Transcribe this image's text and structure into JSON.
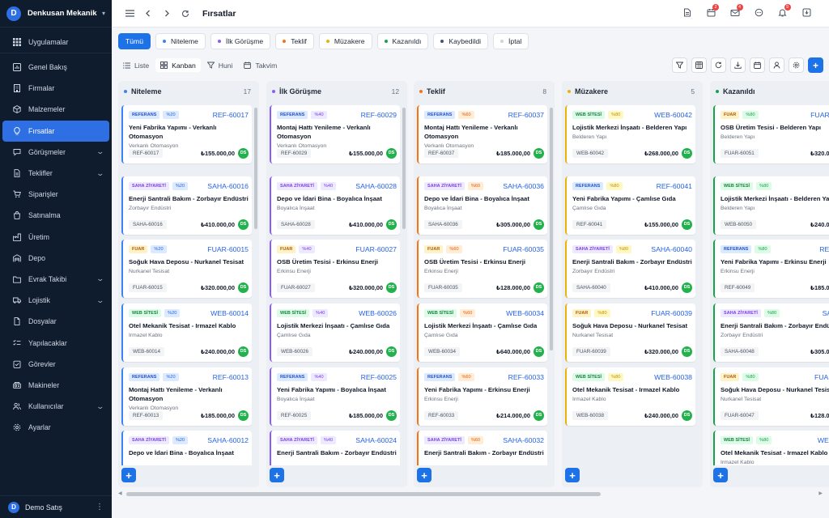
{
  "app": {
    "name": "Denkusan Mekanik San...",
    "logo_letter": "D"
  },
  "sidebar": {
    "items": [
      {
        "label": "Uygulamalar",
        "icon": "grid-icon",
        "chevron": false
      },
      {
        "label": "Genel Bakış",
        "icon": "dashboard-icon",
        "chevron": false
      },
      {
        "label": "Firmalar",
        "icon": "building-icon",
        "chevron": false
      },
      {
        "label": "Malzemeler",
        "icon": "box-icon",
        "chevron": false
      },
      {
        "label": "Fırsatlar",
        "icon": "lightbulb-icon",
        "chevron": false,
        "active": true
      },
      {
        "label": "Görüşmeler",
        "icon": "chat-icon",
        "chevron": true
      },
      {
        "label": "Teklifler",
        "icon": "document-icon",
        "chevron": true
      },
      {
        "label": "Siparişler",
        "icon": "cart-icon",
        "chevron": false
      },
      {
        "label": "Satınalma",
        "icon": "bag-icon",
        "chevron": false
      },
      {
        "label": "Üretim",
        "icon": "factory-icon",
        "chevron": false
      },
      {
        "label": "Depo",
        "icon": "warehouse-icon",
        "chevron": false
      },
      {
        "label": "Evrak Takibi",
        "icon": "folder-icon",
        "chevron": true
      },
      {
        "label": "Lojistik",
        "icon": "truck-icon",
        "chevron": true
      },
      {
        "label": "Dosyalar",
        "icon": "file-icon",
        "chevron": false
      },
      {
        "label": "Yapılacaklar",
        "icon": "checklist-icon",
        "chevron": false
      },
      {
        "label": "Görevler",
        "icon": "task-icon",
        "chevron": false
      },
      {
        "label": "Makineler",
        "icon": "machine-icon",
        "chevron": false
      },
      {
        "label": "Kullanıcılar",
        "icon": "users-icon",
        "chevron": true
      },
      {
        "label": "Ayarlar",
        "icon": "gear-icon",
        "chevron": false
      }
    ],
    "user": {
      "name": "Demo Satış",
      "initial": "D"
    }
  },
  "topbar": {
    "title": "Fırsatlar",
    "badges": {
      "calendar": "2",
      "mail": "4",
      "bell": "9"
    }
  },
  "filters": [
    {
      "label": "Tümü",
      "active": true,
      "color": ""
    },
    {
      "label": "Niteleme",
      "color": "#3b82f6"
    },
    {
      "label": "İlk Görüşme",
      "color": "#8b5cf6"
    },
    {
      "label": "Teklif",
      "color": "#f97316"
    },
    {
      "label": "Müzakere",
      "color": "#eab308"
    },
    {
      "label": "Kazanıldı",
      "color": "#16a34a"
    },
    {
      "label": "Kaybedildi",
      "color": "#475569"
    },
    {
      "label": "İptal",
      "color": "#d1d5db"
    }
  ],
  "views": [
    {
      "label": "Liste",
      "icon": "list-icon"
    },
    {
      "label": "Kanban",
      "icon": "kanban-icon",
      "active": true
    },
    {
      "label": "Huni",
      "icon": "funnel-icon"
    },
    {
      "label": "Takvim",
      "icon": "calendar-icon"
    }
  ],
  "tag_styles": {
    "REFERANS": {
      "bg": "#dbeafe",
      "fg": "#1d4ed8"
    },
    "SAHA ZİYARETİ": {
      "bg": "#ede9fe",
      "fg": "#7c3aed"
    },
    "FUAR": {
      "bg": "#fef3c7",
      "fg": "#b45309"
    },
    "WEB SİTESİ": {
      "bg": "#dcfce7",
      "fg": "#15803d"
    }
  },
  "columns": [
    {
      "title": "Niteleme",
      "count": "17",
      "color": "#3b82f6",
      "prob_bg": "#dbeafe",
      "prob_fg": "#2563eb",
      "cards": [
        {
          "tag": "REFERANS",
          "prob": "%20",
          "ref": "REF-60017",
          "title": "Yeni Fabrika Yapımı - Verkanlı Otomasyon",
          "company": "Verkanlı Otomasyon",
          "code": "REF-60017",
          "amount": "₺155.000,00",
          "owner": "DS"
        },
        {
          "tag": "SAHA ZİYARETİ",
          "prob": "%20",
          "ref": "SAHA-60016",
          "title": "Enerji Santrali Bakım - Zorbayır Endüstri",
          "company": "Zorbayır Endüstri",
          "code": "SAHA-60016",
          "amount": "₺410.000,00",
          "owner": "DS"
        },
        {
          "tag": "FUAR",
          "prob": "%20",
          "ref": "FUAR-60015",
          "title": "Soğuk Hava Deposu - Nurkanel Tesisat",
          "company": "Nurkanel Tesisat",
          "code": "FUAR-60015",
          "amount": "₺320.000,00",
          "owner": "DS"
        },
        {
          "tag": "WEB SİTESİ",
          "prob": "%20",
          "ref": "WEB-60014",
          "title": "Otel Mekanik Tesisat - Irmazel Kablo",
          "company": "Irmazel Kablo",
          "code": "WEB-60014",
          "amount": "₺240.000,00",
          "owner": "DS"
        },
        {
          "tag": "REFERANS",
          "prob": "%20",
          "ref": "REF-60013",
          "title": "Montaj Hattı Yenileme - Verkanlı Otomasyon",
          "company": "Verkanlı Otomasyon",
          "code": "REF-60013",
          "amount": "₺185.000,00",
          "owner": "DS"
        },
        {
          "tag": "SAHA ZİYARETİ",
          "prob": "%20",
          "ref": "SAHA-60012",
          "title": "Depo ve İdari Bina - Boyalıca İnşaat",
          "company": "",
          "code": "",
          "amount": "",
          "owner": ""
        }
      ]
    },
    {
      "title": "İlk Görüşme",
      "count": "12",
      "color": "#8b5cf6",
      "prob_bg": "#ede9fe",
      "prob_fg": "#7c3aed",
      "cards": [
        {
          "tag": "REFERANS",
          "prob": "%40",
          "ref": "REF-60029",
          "title": "Montaj Hattı Yenileme - Verkanlı Otomasyon",
          "company": "Verkanlı Otomasyon",
          "code": "REF-60029",
          "amount": "₺155.000,00",
          "owner": "DS"
        },
        {
          "tag": "SAHA ZİYARETİ",
          "prob": "%40",
          "ref": "SAHA-60028",
          "title": "Depo ve İdari Bina - Boyalıca İnşaat",
          "company": "Boyalıca İnşaat",
          "code": "SAHA-60028",
          "amount": "₺410.000,00",
          "owner": "DS"
        },
        {
          "tag": "FUAR",
          "prob": "%40",
          "ref": "FUAR-60027",
          "title": "OSB Üretim Tesisi - Erkinsu Enerji",
          "company": "Erkinsu Enerji",
          "code": "FUAR-60027",
          "amount": "₺320.000,00",
          "owner": "DS"
        },
        {
          "tag": "WEB SİTESİ",
          "prob": "%40",
          "ref": "WEB-60026",
          "title": "Lojistik Merkezi İnşaatı - Çamlıse Gıda",
          "company": "Çamlıse Gıda",
          "code": "WEB-60026",
          "amount": "₺240.000,00",
          "owner": "DS"
        },
        {
          "tag": "REFERANS",
          "prob": "%40",
          "ref": "REF-60025",
          "title": "Yeni Fabrika Yapımı - Boyalıca İnşaat",
          "company": "Boyalıca İnşaat",
          "code": "REF-60025",
          "amount": "₺185.000,00",
          "owner": "DS"
        },
        {
          "tag": "SAHA ZİYARETİ",
          "prob": "%40",
          "ref": "SAHA-60024",
          "title": "Enerji Santrali Bakım - Zorbayır Endüstri",
          "company": "",
          "code": "",
          "amount": "",
          "owner": ""
        }
      ]
    },
    {
      "title": "Teklif",
      "count": "8",
      "color": "#f97316",
      "prob_bg": "#ffedd5",
      "prob_fg": "#ea580c",
      "cards": [
        {
          "tag": "REFERANS",
          "prob": "%60",
          "ref": "REF-60037",
          "title": "Montaj Hattı Yenileme - Verkanlı Otomasyon",
          "company": "Verkanlı Otomasyon",
          "code": "REF-60037",
          "amount": "₺185.000,00",
          "owner": "DS"
        },
        {
          "tag": "SAHA ZİYARETİ",
          "prob": "%60",
          "ref": "SAHA-60036",
          "title": "Depo ve İdari Bina - Boyalıca İnşaat",
          "company": "Boyalıca İnşaat",
          "code": "SAHA-60036",
          "amount": "₺305.000,00",
          "owner": "DS"
        },
        {
          "tag": "FUAR",
          "prob": "%60",
          "ref": "FUAR-60035",
          "title": "OSB Üretim Tesisi - Erkinsu Enerji",
          "company": "Erkinsu Enerji",
          "code": "FUAR-60035",
          "amount": "₺128.000,00",
          "owner": "DS"
        },
        {
          "tag": "WEB SİTESİ",
          "prob": "%60",
          "ref": "WEB-60034",
          "title": "Lojistik Merkezi İnşaatı - Çamlıse Gıda",
          "company": "Çamlıse Gıda",
          "code": "WEB-60034",
          "amount": "₺640.000,00",
          "owner": "DS"
        },
        {
          "tag": "REFERANS",
          "prob": "%60",
          "ref": "REF-60033",
          "title": "Yeni Fabrika Yapımı - Erkinsu Enerji",
          "company": "Erkinsu Enerji",
          "code": "REF-60033",
          "amount": "₺214.000,00",
          "owner": "DS"
        },
        {
          "tag": "SAHA ZİYARETİ",
          "prob": "%60",
          "ref": "SAHA-60032",
          "title": "Enerji Santrali Bakım - Zorbayır Endüstri",
          "company": "",
          "code": "",
          "amount": "",
          "owner": ""
        }
      ]
    },
    {
      "title": "Müzakere",
      "count": "5",
      "color": "#eab308",
      "prob_bg": "#fef9c3",
      "prob_fg": "#ca8a04",
      "cards": [
        {
          "tag": "WEB SİTESİ",
          "prob": "%80",
          "ref": "WEB-60042",
          "title": "Lojistik Merkezi İnşaatı - Belderen Yapı",
          "company": "Belderen Yapı",
          "code": "WEB-60042",
          "amount": "₺268.000,00",
          "owner": "DS"
        },
        {
          "tag": "REFERANS",
          "prob": "%80",
          "ref": "REF-60041",
          "title": "Yeni Fabrika Yapımı - Çamlıse Gıda",
          "company": "Çamlıse Gıda",
          "code": "REF-60041",
          "amount": "₺155.000,00",
          "owner": "DS"
        },
        {
          "tag": "SAHA ZİYARETİ",
          "prob": "%80",
          "ref": "SAHA-60040",
          "title": "Enerji Santrali Bakım - Zorbayır Endüstri",
          "company": "Zorbayır Endüstri",
          "code": "SAHA-60040",
          "amount": "₺410.000,00",
          "owner": "DS"
        },
        {
          "tag": "FUAR",
          "prob": "%80",
          "ref": "FUAR-60039",
          "title": "Soğuk Hava Deposu - Nurkanel Tesisat",
          "company": "Nurkanel Tesisat",
          "code": "FUAR-60039",
          "amount": "₺320.000,00",
          "owner": "DS"
        },
        {
          "tag": "WEB SİTESİ",
          "prob": "%80",
          "ref": "WEB-60038",
          "title": "Otel Mekanik Tesisat - Irmazel Kablo",
          "company": "Irmazel Kablo",
          "code": "WEB-60038",
          "amount": "₺240.000,00",
          "owner": "DS"
        }
      ]
    },
    {
      "title": "Kazanıldı",
      "count": "",
      "color": "#16a34a",
      "prob_bg": "#dcfce7",
      "prob_fg": "#16a34a",
      "cards": [
        {
          "tag": "FUAR",
          "prob": "%80",
          "ref": "FUAR-6005",
          "title": "OSB Üretim Tesisi - Belderen Yapı",
          "company": "Belderen Yapı",
          "code": "FUAR-60051",
          "amount": "₺320.000,00",
          "owner": ""
        },
        {
          "tag": "WEB SİTESİ",
          "prob": "%80",
          "ref": "",
          "title": "Lojistik Merkezi İnşaatı - Belderen Yapı",
          "company": "Belderen Yapı",
          "code": "WEB-60050",
          "amount": "₺240.000,00",
          "owner": ""
        },
        {
          "tag": "REFERANS",
          "prob": "%80",
          "ref": "REF-600",
          "title": "Yeni Fabrika Yapımı - Erkinsu Enerji",
          "company": "Erkinsu Enerji",
          "code": "REF-60049",
          "amount": "₺185.000,00",
          "owner": ""
        },
        {
          "tag": "SAHA ZİYARETİ",
          "prob": "%80",
          "ref": "SAHA-6",
          "title": "Enerji Santrali Bakım - Zorbayır Endüstri",
          "company": "Zorbayır Endüstri",
          "code": "SAHA-60048",
          "amount": "₺305.000,00",
          "owner": ""
        },
        {
          "tag": "FUAR",
          "prob": "%80",
          "ref": "FUAR-600",
          "title": "Soğuk Hava Deposu - Nurkanel Tesisat",
          "company": "Nurkanel Tesisat",
          "code": "FUAR-60047",
          "amount": "₺128.000,00",
          "owner": ""
        },
        {
          "tag": "WEB SİTESİ",
          "prob": "%80",
          "ref": "WEB-600",
          "title": "Otel Mekanik Tesisat - Irmazel Kablo",
          "company": "Irmazel Kablo",
          "code": "",
          "amount": "",
          "owner": ""
        }
      ]
    }
  ]
}
